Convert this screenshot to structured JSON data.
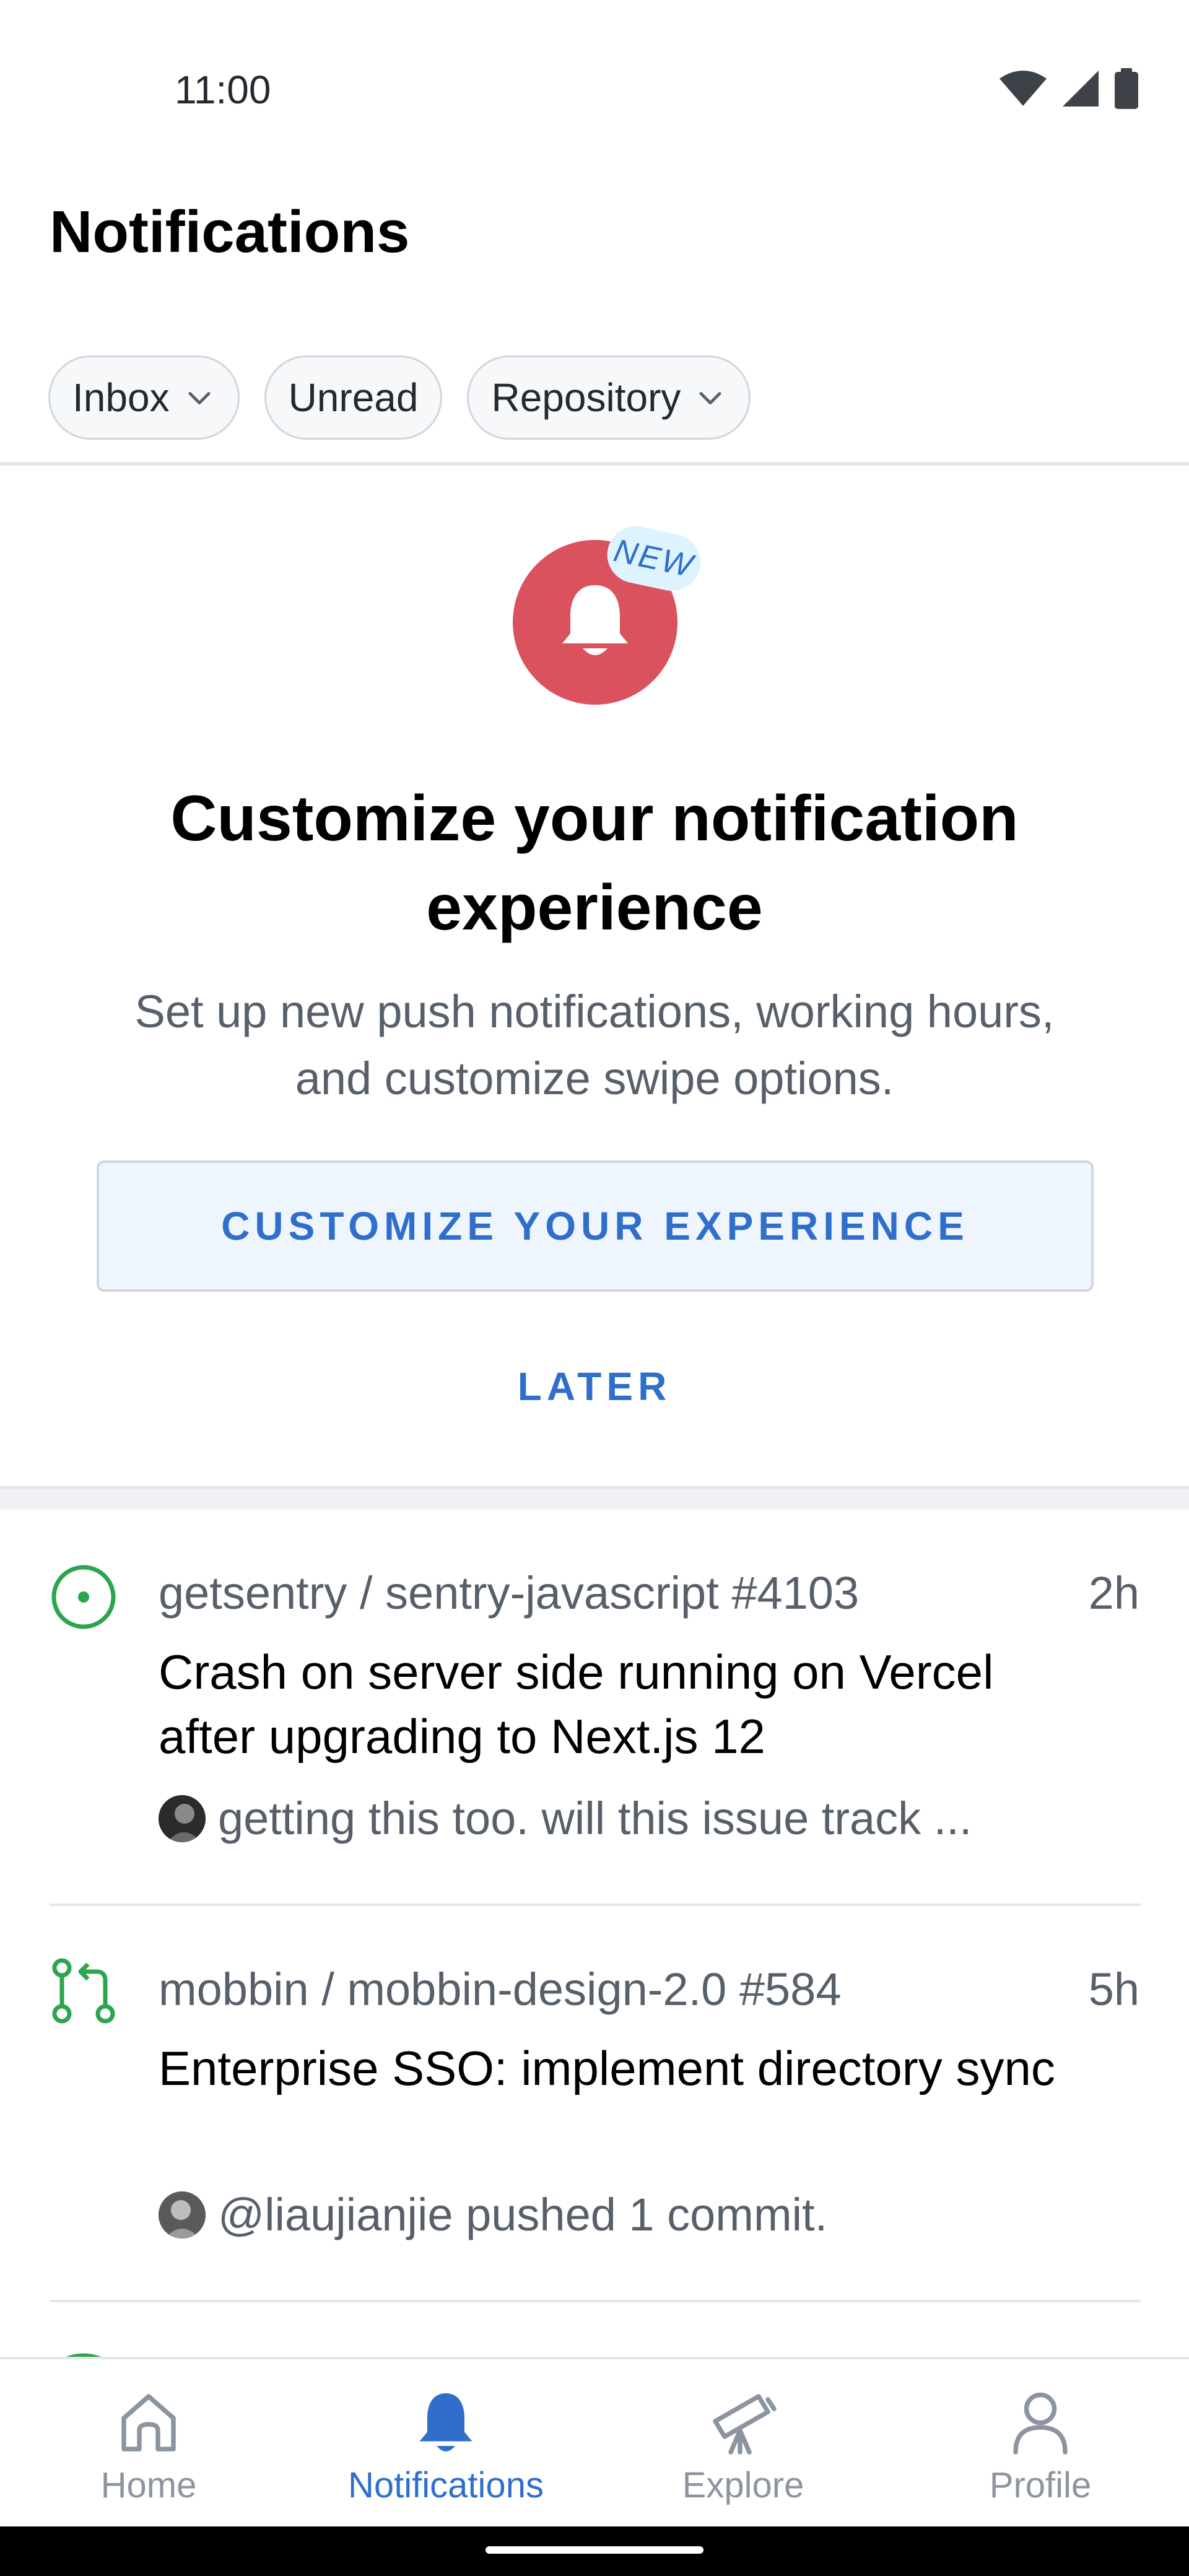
{
  "status_bar": {
    "time": "11:00"
  },
  "header": {
    "title": "Notifications"
  },
  "filters": [
    {
      "label": "Inbox",
      "has_dropdown": true
    },
    {
      "label": "Unread",
      "has_dropdown": false
    },
    {
      "label": "Repository",
      "has_dropdown": true
    }
  ],
  "promo": {
    "badge": "NEW",
    "title": "Customize your notification experience",
    "body": "Set up new push notifications, working hours, and customize swipe options.",
    "primary_button": "CUSTOMIZE YOUR EXPERIENCE",
    "secondary_button": "LATER",
    "icon_color": "#d9525e"
  },
  "notifications": [
    {
      "type": "issue-open",
      "icon": "issue-open-icon",
      "repo": "getsentry / sentry-javascript #4103",
      "time": "2h",
      "title": "Crash on server side running on Vercel after upgrading to Next.js 12",
      "preview": "getting this too. will this issue track ..."
    },
    {
      "type": "pull-request",
      "icon": "pull-request-icon",
      "repo": "mobbin / mobbin-design-2.0 #584",
      "time": "5h",
      "title": "Enterprise SSO: implement directory sync",
      "preview": "@liaujianjie pushed 1 commit."
    }
  ],
  "bottom_nav": [
    {
      "label": "Home",
      "icon": "home-icon",
      "active": false
    },
    {
      "label": "Notifications",
      "icon": "bell-icon",
      "active": true
    },
    {
      "label": "Explore",
      "icon": "telescope-icon",
      "active": false
    },
    {
      "label": "Profile",
      "icon": "person-icon",
      "active": false
    }
  ],
  "colors": {
    "accent": "#2f6fcb",
    "success": "#2da44e",
    "muted_text": "#57606a"
  }
}
